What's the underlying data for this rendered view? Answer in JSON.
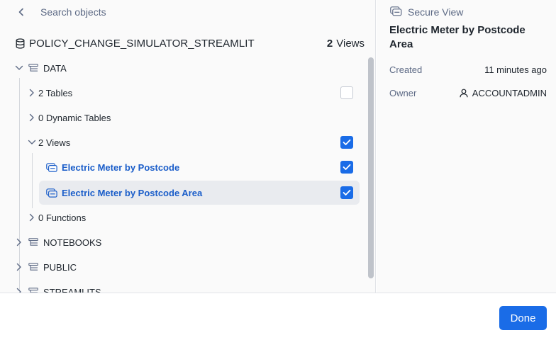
{
  "search": {
    "placeholder": "Search objects"
  },
  "database": {
    "name": "POLICY_CHANGE_SIMULATOR_STREAMLIT",
    "count": "2",
    "count_unit": "Views"
  },
  "tree": {
    "schema_data": "DATA",
    "tables": "2 Tables",
    "dynamic_tables": "0 Dynamic Tables",
    "views": "2 Views",
    "view_items": [
      "Electric Meter by Postcode",
      "Electric Meter by Postcode Area"
    ],
    "functions": "0 Functions",
    "schema_notebooks": "NOTEBOOKS",
    "schema_public": "PUBLIC",
    "schema_streamlits": "STREAMLITS"
  },
  "checkboxes": {
    "tables": false,
    "views": true,
    "view_1": true,
    "view_2": true
  },
  "detail": {
    "type": "Secure View",
    "title": "Electric Meter by Postcode Area",
    "created_label": "Created",
    "created_value": "11 minutes ago",
    "owner_label": "Owner",
    "owner_value": "ACCOUNTADMIN"
  },
  "footer": {
    "done_label": "Done"
  },
  "colors": {
    "accent": "#1a6ce7",
    "link": "#1a5dc9",
    "selected_bg": "#e9ebef"
  }
}
